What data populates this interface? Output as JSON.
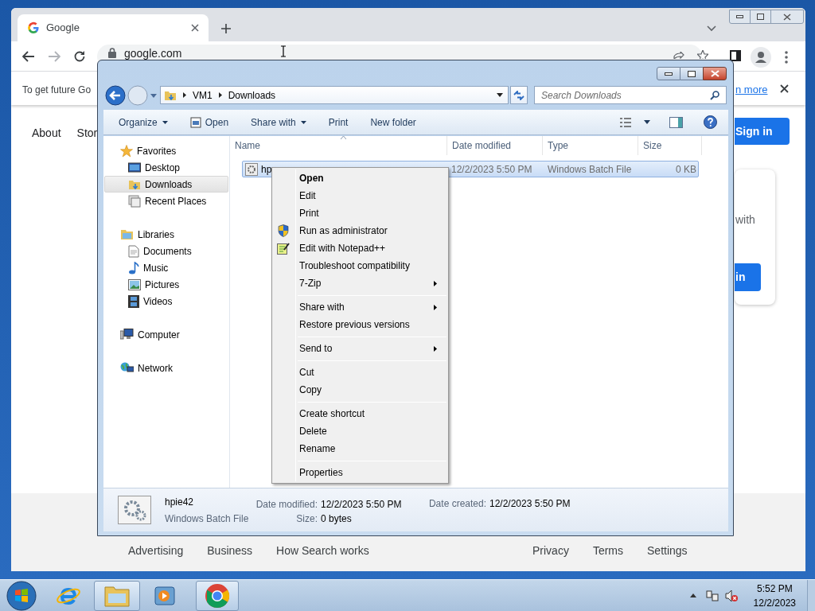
{
  "chrome": {
    "tab": {
      "title": "Google"
    },
    "address": "google.com",
    "infobar": {
      "text": "To get future Go",
      "link": "n more"
    },
    "nav_links": [
      "About",
      "Stor"
    ],
    "sign_in": "Sign in",
    "card": {
      "text": "with",
      "button": "in"
    },
    "footer_left": [
      "Advertising",
      "Business",
      "How Search works"
    ],
    "footer_right": [
      "Privacy",
      "Terms",
      "Settings"
    ]
  },
  "explorer": {
    "breadcrumb": [
      "VM1",
      "Downloads"
    ],
    "search": {
      "placeholder": "Search Downloads"
    },
    "toolbar": [
      {
        "label": "Organize",
        "kind": "dropdown"
      },
      {
        "label": "Open",
        "kind": "icon"
      },
      {
        "label": "Share with",
        "kind": "dropdown"
      },
      {
        "label": "Print",
        "kind": "plain"
      },
      {
        "label": "New folder",
        "kind": "plain"
      }
    ],
    "sidebar": [
      {
        "label": "Favorites",
        "selected": false,
        "children": [
          {
            "label": "Desktop",
            "selected": false
          },
          {
            "label": "Downloads",
            "selected": true
          },
          {
            "label": "Recent Places",
            "selected": false
          }
        ]
      },
      {
        "label": "Libraries",
        "selected": false,
        "children": [
          {
            "label": "Documents",
            "selected": false
          },
          {
            "label": "Music",
            "selected": false
          },
          {
            "label": "Pictures",
            "selected": false
          },
          {
            "label": "Videos",
            "selected": false
          }
        ]
      },
      {
        "label": "Computer",
        "selected": false
      },
      {
        "label": "Network",
        "selected": false
      }
    ],
    "columns": [
      "Name",
      "Date modified",
      "Type",
      "Size"
    ],
    "rows": [
      {
        "name": "hp",
        "date": "12/2/2023 5:50 PM",
        "type": "Windows Batch File",
        "size": "0 KB",
        "selected": true
      }
    ],
    "details": {
      "name": "hpie42",
      "type": "Windows Batch File",
      "fields": [
        {
          "label": "Date modified:",
          "value": "12/2/2023 5:50 PM"
        },
        {
          "label": "Size:",
          "value": "0 bytes"
        },
        {
          "label": "Date created:",
          "value": "12/2/2023 5:50 PM"
        }
      ]
    }
  },
  "context_menu": {
    "groups": [
      [
        {
          "label": "Open",
          "default": true,
          "submenu": false
        },
        {
          "label": "Edit",
          "default": false,
          "submenu": false
        },
        {
          "label": "Print",
          "default": false,
          "submenu": false
        },
        {
          "label": "Run as administrator",
          "default": false,
          "submenu": false
        },
        {
          "label": "Edit with Notepad++",
          "default": false,
          "submenu": false
        },
        {
          "label": "Troubleshoot compatibility",
          "default": false,
          "submenu": false
        },
        {
          "label": "7-Zip",
          "default": false,
          "submenu": true
        }
      ],
      [
        {
          "label": "Share with",
          "default": false,
          "submenu": true
        },
        {
          "label": "Restore previous versions",
          "default": false,
          "submenu": false
        }
      ],
      [
        {
          "label": "Send to",
          "default": false,
          "submenu": true
        }
      ],
      [
        {
          "label": "Cut",
          "default": false,
          "submenu": false
        },
        {
          "label": "Copy",
          "default": false,
          "submenu": false
        }
      ],
      [
        {
          "label": "Create shortcut",
          "default": false,
          "submenu": false
        },
        {
          "label": "Delete",
          "default": false,
          "submenu": false
        },
        {
          "label": "Rename",
          "default": false,
          "submenu": false
        }
      ],
      [
        {
          "label": "Properties",
          "default": false,
          "submenu": false
        }
      ]
    ]
  },
  "taskbar": {
    "apps": [
      {
        "selected": false
      },
      {
        "selected": true
      },
      {
        "selected": false
      },
      {
        "selected": true
      }
    ],
    "clock": {
      "time": "5:52 PM",
      "date": "12/2/2023"
    }
  }
}
